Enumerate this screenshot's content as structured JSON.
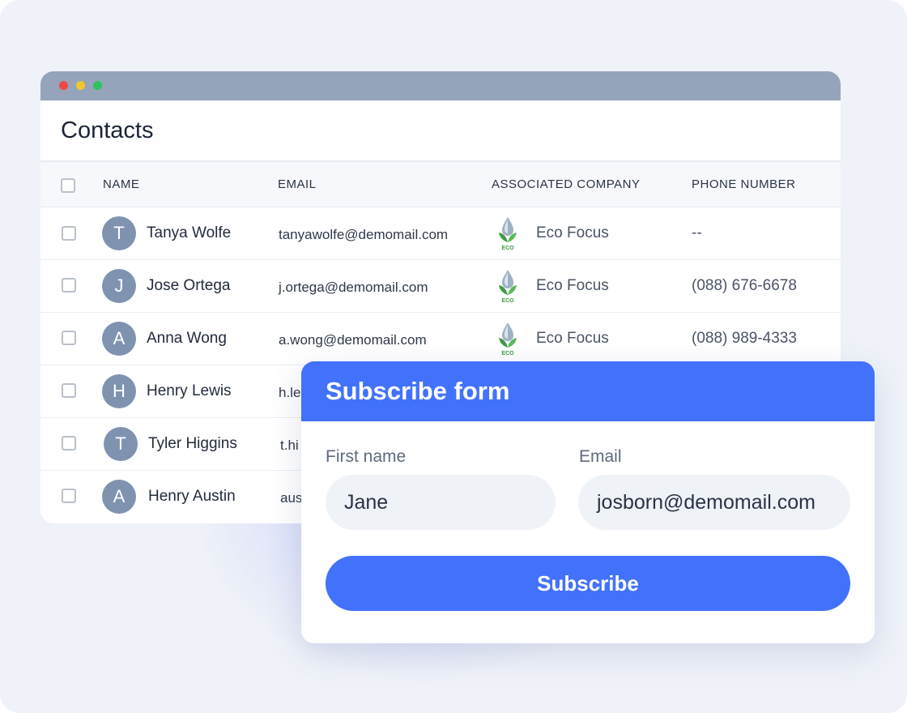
{
  "contacts_window": {
    "title": "Contacts",
    "columns": [
      "NAME",
      "EMAIL",
      "ASSOCIATED COMPANY",
      "PHONE NUMBER"
    ],
    "rows": [
      {
        "initial": "T",
        "name": "Tanya Wolfe",
        "email": "tanyawolfe@demomail.com",
        "company": "Eco Focus",
        "phone": "--"
      },
      {
        "initial": "J",
        "name": "Jose Ortega",
        "email": "j.ortega@demomail.com",
        "company": "Eco Focus",
        "phone": "(088) 676-6678"
      },
      {
        "initial": "A",
        "name": "Anna Wong",
        "email": "a.wong@demomail.com",
        "company": "Eco Focus",
        "phone": "(088) 989-4333"
      },
      {
        "initial": "H",
        "name": "Henry Lewis",
        "email": "h.le",
        "company": "",
        "phone": ""
      },
      {
        "initial": "T",
        "name": "Tyler Higgins",
        "email": "t.hi",
        "company": "",
        "phone": ""
      },
      {
        "initial": "A",
        "name": "Henry Austin",
        "email": "aus",
        "company": "",
        "phone": ""
      }
    ],
    "company_logo_text": "ECO"
  },
  "subscribe_form": {
    "title": "Subscribe form",
    "first_name_label": "First name",
    "first_name_value": "Jane",
    "email_label": "Email",
    "email_value": "josborn@demomail.com",
    "submit_label": "Subscribe"
  },
  "colors": {
    "accent": "#4272fb",
    "titlebar": "#95a4bb",
    "avatar": "#7f93b1",
    "background": "#eff2f8"
  }
}
